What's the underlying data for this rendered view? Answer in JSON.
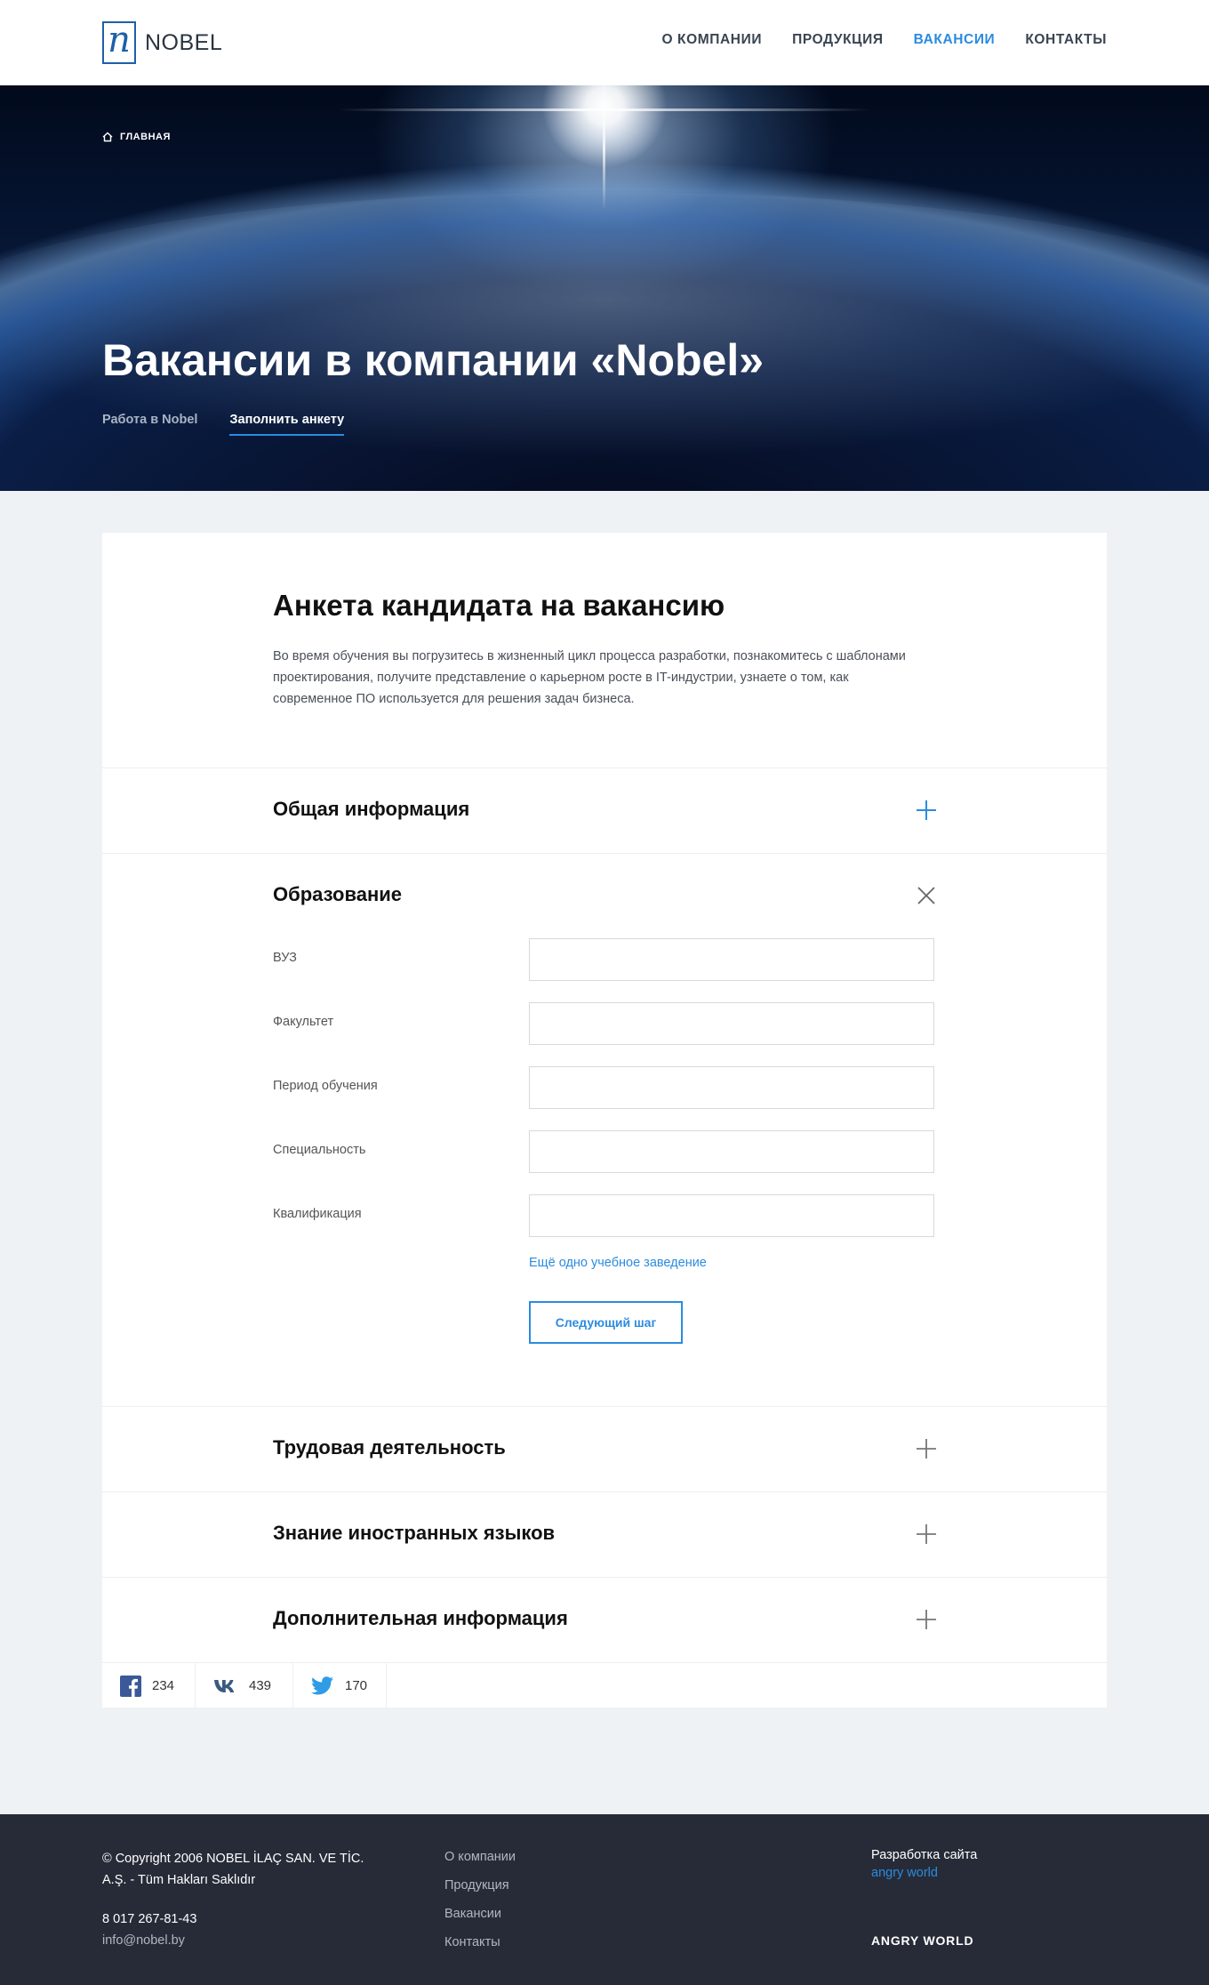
{
  "header": {
    "logo_text": "NOBEL",
    "nav": [
      {
        "label": "О КОМПАНИИ"
      },
      {
        "label": "ПРОДУКЦИЯ"
      },
      {
        "label": "ВАКАНСИИ"
      },
      {
        "label": "КОНТАКТЫ"
      }
    ],
    "active_nav": "ВАКАНСИИ"
  },
  "hero": {
    "breadcrumb": "ГЛАВНАЯ",
    "title": "Вакансии в компании «Nobel»",
    "tabs": [
      {
        "label": "Работа в Nobel"
      },
      {
        "label": "Заполнить анкету"
      }
    ],
    "active_tab": "Заполнить анкету"
  },
  "form": {
    "title": "Анкета кандидата на вакансию",
    "description": "Во время обучения вы погрузитесь в жизненный цикл процесса разработки, познакомитесь с шаблонами проектирования, получите представление о карьерном росте в IT-индустрии, узнаете о том, как современное ПО используется для решения задач бизнеса.",
    "sections": [
      {
        "title": "Общая информация",
        "state": "collapsed"
      },
      {
        "title": "Образование",
        "state": "expanded"
      },
      {
        "title": "Трудовая деятельность",
        "state": "collapsed"
      },
      {
        "title": "Знание иностранных языков",
        "state": "collapsed"
      },
      {
        "title": "Дополнительная информация",
        "state": "collapsed"
      }
    ],
    "education_fields": [
      {
        "label": "ВУЗ",
        "value": ""
      },
      {
        "label": "Факультет",
        "value": ""
      },
      {
        "label": "Период обучения",
        "value": ""
      },
      {
        "label": "Специальность",
        "value": ""
      },
      {
        "label": "Квалификация",
        "value": ""
      }
    ],
    "add_link": "Ещё одно учебное заведение",
    "next_button": "Следующий шаг"
  },
  "share": [
    {
      "network": "facebook",
      "icon": "facebook-icon",
      "count": "234",
      "color": "#3b5998"
    },
    {
      "network": "vk",
      "icon": "vk-icon",
      "count": "439",
      "color": "#3a5a80"
    },
    {
      "network": "twitter",
      "icon": "twitter-icon",
      "count": "170",
      "color": "#2f9ce6"
    }
  ],
  "footer": {
    "copyright": "© Copyright 2006 NOBEL İLAÇ SAN. VE TİC. A.Ş. - Tüm Hakları Saklıdır",
    "phone": "8 017 267-81-43",
    "email": "info@nobel.by",
    "nav": [
      {
        "label": "О компании"
      },
      {
        "label": "Продукция"
      },
      {
        "label": "Вакансии"
      },
      {
        "label": "Контакты"
      }
    ],
    "dev_label": "Разработка сайта",
    "dev_link": "angry world",
    "dev_brand": "ANGRY WORLD"
  },
  "colors": {
    "accent": "#2b8be0",
    "footer_bg": "#262b37",
    "page_bg": "#eff2f5"
  }
}
